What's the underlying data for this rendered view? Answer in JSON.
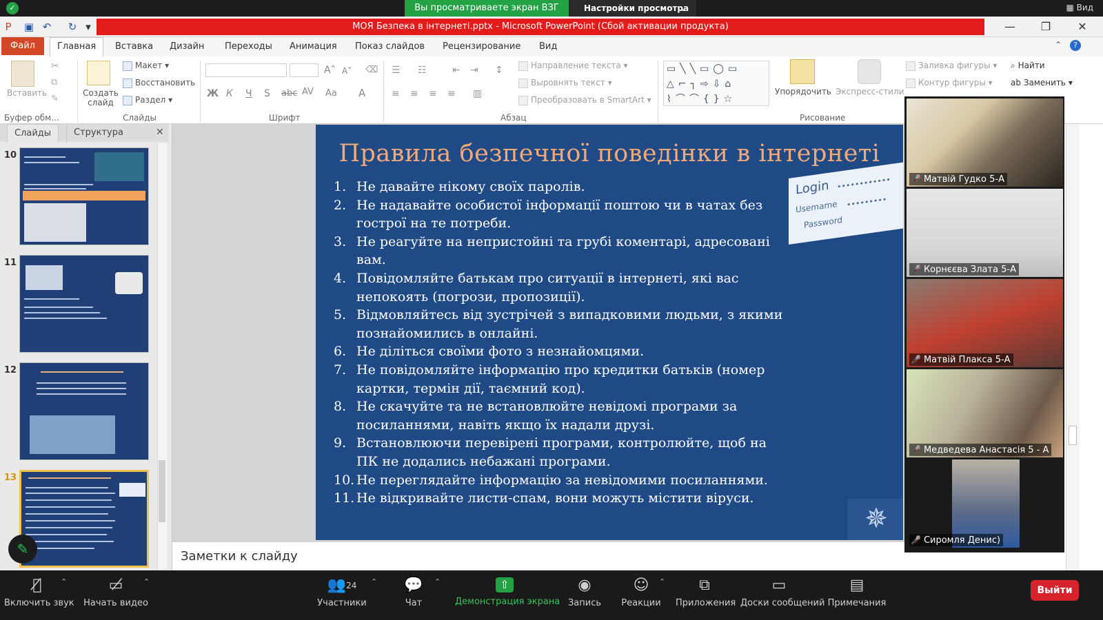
{
  "zoom": {
    "banner_text": "Вы просматриваете экран ВЗГ УПП",
    "view_options": "Настройки просмотра",
    "view_label": "Вид",
    "toolbar": {
      "mute": "Включить звук",
      "video": "Начать видео",
      "participants": "Участники",
      "participants_count": "24",
      "chat": "Чат",
      "share": "Демонстрация экрана",
      "record": "Запись",
      "reactions": "Реакции",
      "apps": "Приложения",
      "whiteboards": "Доски сообщений",
      "notes": "Примечания",
      "leave": "Выйти"
    },
    "participants": [
      {
        "name": "Матвій Гудко 5-А"
      },
      {
        "name": "Корнєєва Злата 5-А"
      },
      {
        "name": "Матвій Плакса 5-А"
      },
      {
        "name": "Медведева Анастасія 5 - А"
      },
      {
        "name": "Сиромля Денис)"
      }
    ]
  },
  "ppt": {
    "window_title": "МОЯ Безпека в інтернеті.pptx  -  Microsoft PowerPoint (Сбой активации продукта)",
    "tabs": [
      "Файл",
      "Главная",
      "Вставка",
      "Дизайн",
      "Переходы",
      "Анимация",
      "Показ слайдов",
      "Рецензирование",
      "Вид"
    ],
    "ribbon": {
      "paste": "Вставить",
      "clipboard_group": "Буфер обм...",
      "create_slide": "Создать слайд",
      "layout": "Макет",
      "reset": "Восстановить",
      "section": "Раздел",
      "slides_group": "Слайды",
      "font_group": "Шрифт",
      "paragraph_group": "Абзац",
      "text_direction": "Направление текста",
      "align_text": "Выровнять текст",
      "smartart": "Преобразовать в SmartArt",
      "arrange": "Упорядочить",
      "quick_styles": "Экспресс-стили",
      "shape_fill": "Заливка фигуры",
      "shape_outline": "Контур фигуры",
      "drawing_group": "Рисование",
      "find": "Найти",
      "replace": "Заменить"
    },
    "pane_tabs": [
      "Слайды",
      "Структура"
    ],
    "thumbnails": [
      {
        "num": "10"
      },
      {
        "num": "11"
      },
      {
        "num": "12"
      },
      {
        "num": "13"
      }
    ],
    "notes_placeholder": "Заметки к слайду",
    "slide": {
      "title": "Правила безпечної поведінки в інтернеті",
      "login_image": {
        "login": "Login",
        "username": "Usemame",
        "password": "Password"
      },
      "rules": [
        {
          "n": "1.",
          "text": "Не давайте нікому своїх паролів."
        },
        {
          "n": "2.",
          "text": "Не надавайте особистої інформації поштою чи в чатах без гострої на те потреби."
        },
        {
          "n": "3.",
          "text": "Не реагуйте на непристойні та грубі коментарі, адресовані вам."
        },
        {
          "n": "4.",
          "text": "Повідомляйте батькам про ситуації в інтернеті, які вас непокоять (погрози, пропозиції)."
        },
        {
          "n": "5.",
          "text": "Відмовляйтесь від зустрічей з випадковими людьми, з якими познайомились в онлайні."
        },
        {
          "n": "6.",
          "text": "Не діліться своїми фото з незнайомцями."
        },
        {
          "n": "7.",
          "text": "Не повідомляйте інформацію про кредитки батьків (номер картки, термін дії, таємний код)."
        },
        {
          "n": "8.",
          "text": "Не скачуйте та не встановлюйте невідомі програми за посиланнями, навіть якщо їх надали друзі."
        },
        {
          "n": "9.",
          "text": "Встановлюючи перевірені програми, контролюйте, щоб на ПК не додались небажані програми."
        },
        {
          "n": "10.",
          "text": "Не переглядайте інформацію за невідомими посиланнями."
        },
        {
          "n": "11.",
          "text": "Не відкривайте листи-спам, вони можуть містити віруси."
        }
      ]
    }
  }
}
